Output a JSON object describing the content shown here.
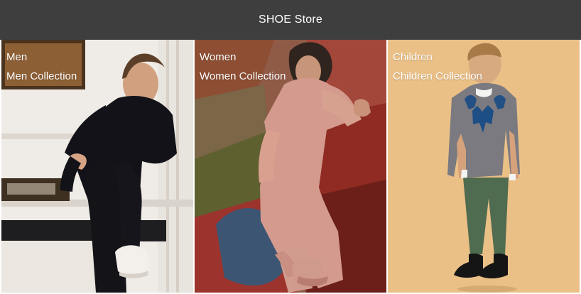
{
  "header": {
    "title": "SHOE Store",
    "background": "#3e3e3e"
  },
  "categories": [
    {
      "name": "Men",
      "collection": "Men Collection"
    },
    {
      "name": "Women",
      "collection": "Women Collection"
    },
    {
      "name": "Children",
      "collection": "Children Collection"
    }
  ],
  "icons": {
    "men_image": "man-sitting-photo-icon",
    "women_image": "woman-reclining-photo-icon",
    "children_image": "boy-standing-photo-icon"
  }
}
